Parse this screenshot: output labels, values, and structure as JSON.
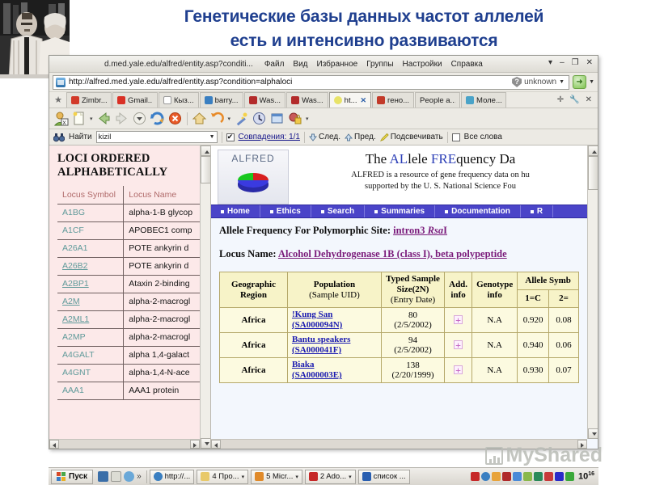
{
  "slide": {
    "title_line1": "Генетические базы данных частот аллелей",
    "title_line2": "есть и интенсивно развиваются",
    "photo_alt": "photo-two-people",
    "title_color": "#1f3f8f"
  },
  "browser": {
    "titlebar_url": "d.med.yale.edu/alfred/entity.asp?conditi...",
    "menus": [
      "Файл",
      "Вид",
      "Избранное",
      "Группы",
      "Настройки",
      "Справка"
    ],
    "window_buttons": [
      "▾",
      "–",
      "❐",
      "✕"
    ],
    "address": {
      "url": "http://alfred.med.yale.edu/alfred/entity.asp?condition=alphaloci",
      "zone": "unknown",
      "go_label": "Go"
    },
    "tabs": [
      {
        "label": "Zimbr...",
        "color": "#d23a2a",
        "active": false
      },
      {
        "label": "Gmail...",
        "color": "#d93025",
        "active": false
      },
      {
        "label": "Кыз...",
        "color": "#4a4a4a",
        "active": false
      },
      {
        "label": "barry...",
        "color": "#3a7fc1",
        "active": false
      },
      {
        "label": "Was...",
        "color": "#b32b2b",
        "active": false
      },
      {
        "label": "Was...",
        "color": "#b32b2b",
        "active": false
      },
      {
        "label": "ht...",
        "color": "#e8e368",
        "active": true
      },
      {
        "label": "гено...",
        "color": "#c23a2a",
        "active": false
      },
      {
        "label": "People a...",
        "color": "#9aa0a8",
        "active": false
      },
      {
        "label": "Моле...",
        "color": "#4aa3c8",
        "active": false
      }
    ],
    "tabstrip_right": [
      "✛",
      "🔧",
      "✕"
    ],
    "toolbar_icons": [
      "user-icon",
      "new-page-icon",
      "back-icon",
      "forward-icon",
      "history-dropdown-icon",
      "reload-icon",
      "stop-icon",
      "home-icon",
      "undo-icon",
      "wand-icon",
      "clock-icon",
      "window-icon",
      "security-icon"
    ],
    "findbar": {
      "label": "Найти",
      "query": "kizil",
      "matches_checkbox": true,
      "matches_label": "Совпадения: 1/1",
      "next_label": "След.",
      "prev_label": "Пред.",
      "highlight_label": "Подсвечивать",
      "whole_words_checked": false,
      "whole_words_label": "Все слова"
    }
  },
  "left_frame": {
    "title": "LOCI ORDERED ALPHABETICALLY",
    "headers": [
      "Locus Symbol",
      "Locus Name"
    ],
    "rows": [
      {
        "symbol": "A1BG",
        "name": "alpha-1-B glycop",
        "link": false
      },
      {
        "symbol": "A1CF",
        "name": "APOBEC1 comp",
        "link": false
      },
      {
        "symbol": "A26A1",
        "name": "POTE ankyrin d",
        "link": false
      },
      {
        "symbol": "A26B2",
        "name": "POTE ankyrin d",
        "link": true
      },
      {
        "symbol": "A2BP1",
        "name": "Ataxin 2-binding",
        "link": true
      },
      {
        "symbol": "A2M",
        "name": "alpha-2-macrogl",
        "link": true
      },
      {
        "symbol": "A2ML1",
        "name": "alpha-2-macrogl",
        "link": true
      },
      {
        "symbol": "A2MP",
        "name": "alpha-2-macrogl",
        "link": false
      },
      {
        "symbol": "A4GALT",
        "name": "alpha 1,4-galact",
        "link": false
      },
      {
        "symbol": "A4GNT",
        "name": "alpha-1,4-N-ace",
        "link": false
      },
      {
        "symbol": "AAA1",
        "name": "AAA1 protein",
        "link": false
      }
    ]
  },
  "alfred": {
    "logo_word": "ALFRED",
    "title_prefix": "The ",
    "title_al": "AL",
    "title_lele": "lele ",
    "title_fre": "FRE",
    "title_quency": "quency Da",
    "subtitle_line1": "ALFRED is a resource of gene frequency data on hu",
    "subtitle_line2": "supported by the U. S. National Science Fou",
    "nav": [
      "Home",
      "Ethics",
      "Search",
      "Summaries",
      "Documentation",
      "R"
    ],
    "nav_color": "#4a44c8",
    "heading1_label": "Allele Frequency For Polymorphic Site: ",
    "heading1_link_a": "intron3 ",
    "heading1_link_b": "Rsa",
    "heading1_link_c": "I",
    "heading2_label": "Locus Name: ",
    "heading2_link": "Alcohol Dehydrogenase 1B (class I), beta polypeptide"
  },
  "data_table": {
    "headers": {
      "geographic_region": "Geographic Region",
      "population": "Population",
      "population_sub": "(Sample UID)",
      "typed_sample": "Typed Sample",
      "typed_sample_2": "Size(2N)",
      "typed_sample_3": "(Entry Date)",
      "add_info": "Add. info",
      "genotype_info": "Genotype info",
      "allele_symbol": "Allele Symb",
      "allele_1": "1=C",
      "allele_2": "2="
    },
    "rows": [
      {
        "region": "Africa",
        "population": "!Kung San",
        "uid": "(SA000094N)",
        "size": "80",
        "date": "(2/5/2002)",
        "add_info": "+",
        "genotype_info": "N.A",
        "freq1": "0.920",
        "freq2": "0.08"
      },
      {
        "region": "Africa",
        "population": "Bantu speakers",
        "uid": "(SA000041F)",
        "size": "94",
        "date": "(2/5/2002)",
        "add_info": "+",
        "genotype_info": "N.A",
        "freq1": "0.940",
        "freq2": "0.06"
      },
      {
        "region": "Africa",
        "population": "Biaka",
        "uid": "(SA000003E)",
        "size": "138",
        "date": "(2/20/1999)",
        "add_info": "+",
        "genotype_info": "N.A",
        "freq1": "0.930",
        "freq2": "0.07"
      }
    ]
  },
  "taskbar": {
    "start_label": "Пуск",
    "quicklaunch": [
      "desktop-icon",
      "mail-icon",
      "browser-icon"
    ],
    "chevron": "»",
    "items": [
      {
        "label": "http://...",
        "icon_color": "#3a7fc1",
        "has_caret": false
      },
      {
        "label": "4 Про...",
        "icon_color": "#e8c96a",
        "has_caret": true
      },
      {
        "label": "5 Micr...",
        "icon_color": "#e08a2a",
        "has_caret": true
      },
      {
        "label": "2 Ado...",
        "icon_color": "#c62828",
        "has_caret": true
      },
      {
        "label": "список ...",
        "icon_color": "#2a5fb0",
        "has_caret": false
      }
    ],
    "tray_icons": [
      "#c62828",
      "#3a7fc1",
      "#e8a33a",
      "#b02a2a",
      "#4a8ad8",
      "#8ab84a",
      "#2a8a5a",
      "#c83a3a",
      "#2a2ac8",
      "#3aa83a"
    ],
    "clock": "10",
    "clock_sup": "16"
  },
  "watermark": {
    "text": "MyShared"
  }
}
